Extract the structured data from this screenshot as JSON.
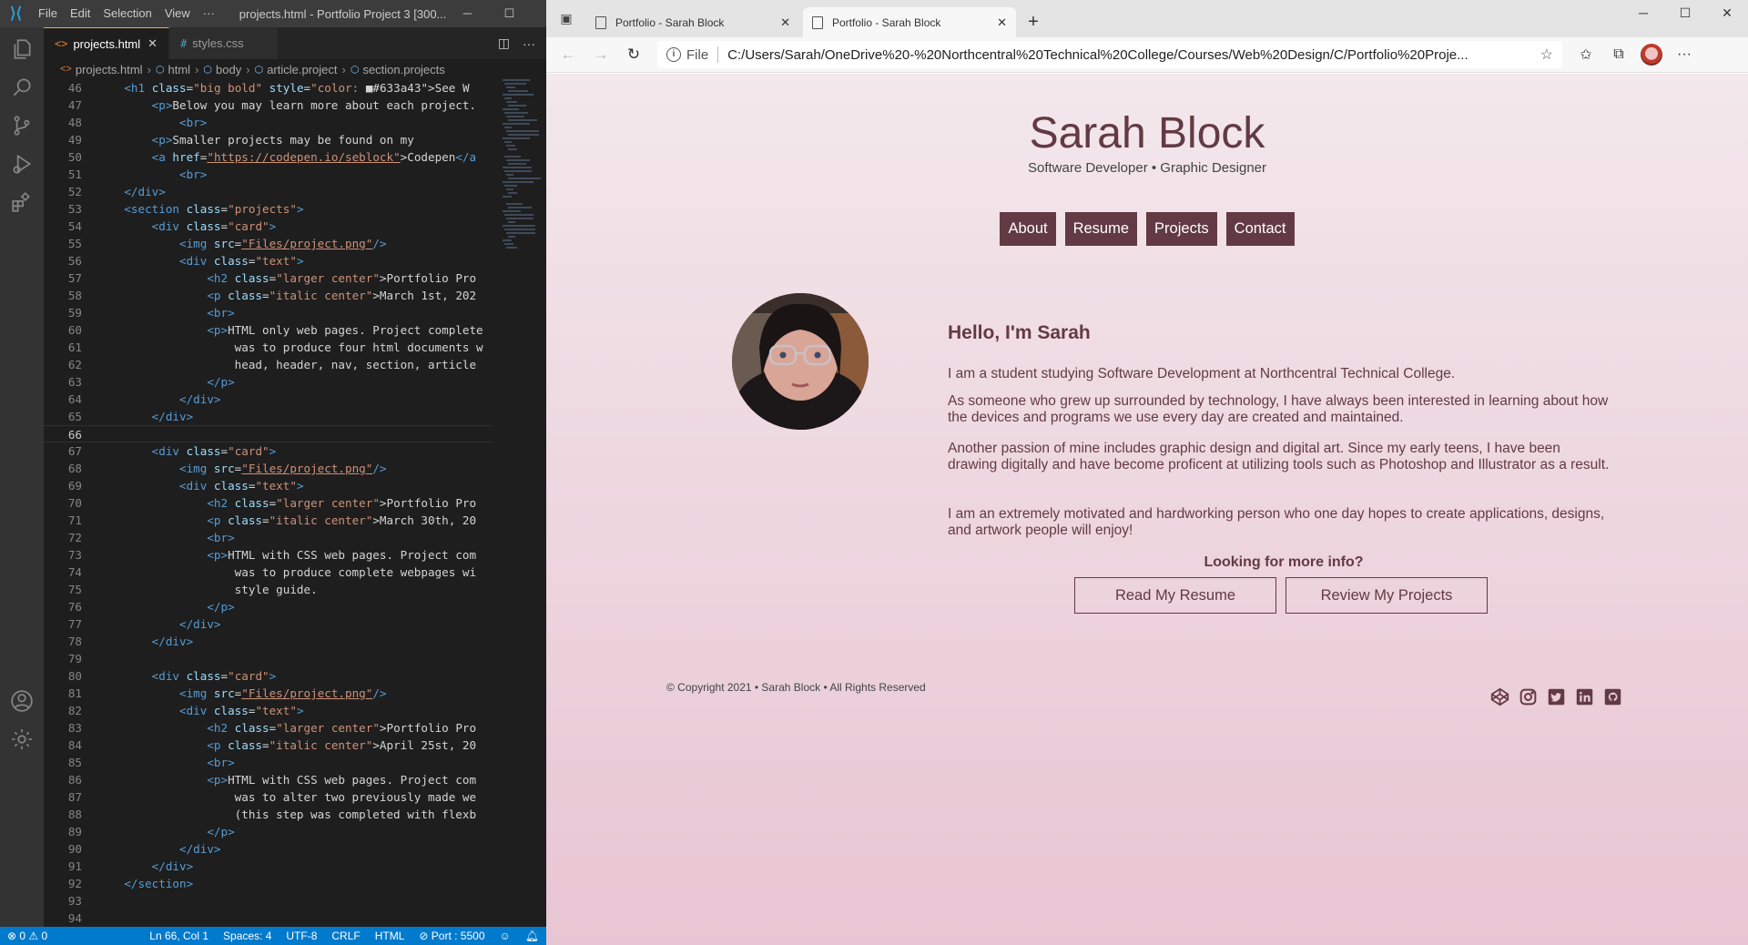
{
  "vscode": {
    "title": "projects.html - Portfolio Project 3 [300...",
    "menu": [
      "File",
      "Edit",
      "Selection",
      "View",
      "···"
    ],
    "tabs": [
      {
        "label": "projects.html",
        "active": true,
        "icon": "html-file-icon"
      },
      {
        "label": "styles.css",
        "active": false,
        "icon": "css-file-icon"
      }
    ],
    "breadcrumb": [
      "projects.html",
      "html",
      "body",
      "article.project",
      "section.projects"
    ],
    "code_lines": [
      {
        "n": 46,
        "ind": 4,
        "t": [
          [
            "tag",
            "<h1 "
          ],
          [
            "attr",
            "class"
          ],
          [
            "text",
            "="
          ],
          [
            "str",
            "\"big bold\""
          ],
          [
            "text",
            " "
          ],
          [
            "attr",
            "style"
          ],
          [
            "text",
            "="
          ],
          [
            "str",
            "\"color: "
          ],
          [
            "text",
            "■#633a43\">See W"
          ]
        ]
      },
      {
        "n": 47,
        "ind": 8,
        "t": [
          [
            "tag",
            "<p>"
          ],
          [
            "text",
            "Below you may learn more about each project."
          ]
        ]
      },
      {
        "n": 48,
        "ind": 12,
        "t": [
          [
            "tag",
            "<br>"
          ]
        ]
      },
      {
        "n": 49,
        "ind": 8,
        "t": [
          [
            "tag",
            "<p>"
          ],
          [
            "text",
            "Smaller projects may be found on my"
          ]
        ]
      },
      {
        "n": 50,
        "ind": 8,
        "t": [
          [
            "tag",
            "<a "
          ],
          [
            "attr",
            "href"
          ],
          [
            "text",
            "="
          ],
          [
            "link",
            "\"https://codepen.io/seblock\""
          ],
          [
            "text",
            ">Codepen"
          ],
          [
            "tag",
            "</a"
          ]
        ]
      },
      {
        "n": 51,
        "ind": 12,
        "t": [
          [
            "tag",
            "<br>"
          ]
        ]
      },
      {
        "n": 52,
        "ind": 4,
        "t": [
          [
            "tag",
            "</div>"
          ]
        ]
      },
      {
        "n": 53,
        "ind": 4,
        "t": [
          [
            "tag",
            "<section "
          ],
          [
            "attr",
            "class"
          ],
          [
            "text",
            "="
          ],
          [
            "str",
            "\"projects\""
          ],
          [
            "tag",
            ">"
          ]
        ]
      },
      {
        "n": 54,
        "ind": 8,
        "t": [
          [
            "tag",
            "<div "
          ],
          [
            "attr",
            "class"
          ],
          [
            "text",
            "="
          ],
          [
            "str",
            "\"card\""
          ],
          [
            "tag",
            ">"
          ]
        ]
      },
      {
        "n": 55,
        "ind": 12,
        "t": [
          [
            "tag",
            "<img "
          ],
          [
            "attr",
            "src"
          ],
          [
            "text",
            "="
          ],
          [
            "link",
            "\"Files/project.png\""
          ],
          [
            "tag",
            "/>"
          ]
        ]
      },
      {
        "n": 56,
        "ind": 12,
        "t": [
          [
            "tag",
            "<div "
          ],
          [
            "attr",
            "class"
          ],
          [
            "text",
            "="
          ],
          [
            "str",
            "\"text\""
          ],
          [
            "tag",
            ">"
          ]
        ]
      },
      {
        "n": 57,
        "ind": 16,
        "t": [
          [
            "tag",
            "<h2 "
          ],
          [
            "attr",
            "class"
          ],
          [
            "text",
            "="
          ],
          [
            "str",
            "\"larger center\""
          ],
          [
            "text",
            ">Portfolio Pro"
          ]
        ]
      },
      {
        "n": 58,
        "ind": 16,
        "t": [
          [
            "tag",
            "<p "
          ],
          [
            "attr",
            "class"
          ],
          [
            "text",
            "="
          ],
          [
            "str",
            "\"italic center\""
          ],
          [
            "text",
            ">March 1st, 202"
          ]
        ]
      },
      {
        "n": 59,
        "ind": 16,
        "t": [
          [
            "tag",
            "<br>"
          ]
        ]
      },
      {
        "n": 60,
        "ind": 16,
        "t": [
          [
            "tag",
            "<p>"
          ],
          [
            "text",
            "HTML only web pages. Project complete"
          ]
        ]
      },
      {
        "n": 61,
        "ind": 20,
        "t": [
          [
            "text",
            "was to produce four html documents w"
          ]
        ]
      },
      {
        "n": 62,
        "ind": 20,
        "t": [
          [
            "text",
            "head, header, nav, section, article"
          ]
        ]
      },
      {
        "n": 63,
        "ind": 16,
        "t": [
          [
            "tag",
            "</p>"
          ]
        ]
      },
      {
        "n": 64,
        "ind": 12,
        "t": [
          [
            "tag",
            "</div>"
          ]
        ]
      },
      {
        "n": 65,
        "ind": 8,
        "t": [
          [
            "tag",
            "</div>"
          ]
        ]
      },
      {
        "n": 66,
        "ind": 0,
        "t": [],
        "current": true
      },
      {
        "n": 67,
        "ind": 8,
        "t": [
          [
            "tag",
            "<div "
          ],
          [
            "attr",
            "class"
          ],
          [
            "text",
            "="
          ],
          [
            "str",
            "\"card\""
          ],
          [
            "tag",
            ">"
          ]
        ]
      },
      {
        "n": 68,
        "ind": 12,
        "t": [
          [
            "tag",
            "<img "
          ],
          [
            "attr",
            "src"
          ],
          [
            "text",
            "="
          ],
          [
            "link",
            "\"Files/project.png\""
          ],
          [
            "tag",
            "/>"
          ]
        ]
      },
      {
        "n": 69,
        "ind": 12,
        "t": [
          [
            "tag",
            "<div "
          ],
          [
            "attr",
            "class"
          ],
          [
            "text",
            "="
          ],
          [
            "str",
            "\"text\""
          ],
          [
            "tag",
            ">"
          ]
        ]
      },
      {
        "n": 70,
        "ind": 16,
        "t": [
          [
            "tag",
            "<h2 "
          ],
          [
            "attr",
            "class"
          ],
          [
            "text",
            "="
          ],
          [
            "str",
            "\"larger center\""
          ],
          [
            "text",
            ">Portfolio Pro"
          ]
        ]
      },
      {
        "n": 71,
        "ind": 16,
        "t": [
          [
            "tag",
            "<p "
          ],
          [
            "attr",
            "class"
          ],
          [
            "text",
            "="
          ],
          [
            "str",
            "\"italic center\""
          ],
          [
            "text",
            ">March 30th, 20"
          ]
        ]
      },
      {
        "n": 72,
        "ind": 16,
        "t": [
          [
            "tag",
            "<br>"
          ]
        ]
      },
      {
        "n": 73,
        "ind": 16,
        "t": [
          [
            "tag",
            "<p>"
          ],
          [
            "text",
            "HTML with CSS web pages. Project com"
          ]
        ]
      },
      {
        "n": 74,
        "ind": 20,
        "t": [
          [
            "text",
            "was to produce complete webpages wi"
          ]
        ]
      },
      {
        "n": 75,
        "ind": 20,
        "t": [
          [
            "text",
            "style guide."
          ]
        ]
      },
      {
        "n": 76,
        "ind": 16,
        "t": [
          [
            "tag",
            "</p>"
          ]
        ]
      },
      {
        "n": 77,
        "ind": 12,
        "t": [
          [
            "tag",
            "</div>"
          ]
        ]
      },
      {
        "n": 78,
        "ind": 8,
        "t": [
          [
            "tag",
            "</div>"
          ]
        ]
      },
      {
        "n": 79,
        "ind": 0,
        "t": []
      },
      {
        "n": 80,
        "ind": 8,
        "t": [
          [
            "tag",
            "<div "
          ],
          [
            "attr",
            "class"
          ],
          [
            "text",
            "="
          ],
          [
            "str",
            "\"card\""
          ],
          [
            "tag",
            ">"
          ]
        ]
      },
      {
        "n": 81,
        "ind": 12,
        "t": [
          [
            "tag",
            "<img "
          ],
          [
            "attr",
            "src"
          ],
          [
            "text",
            "="
          ],
          [
            "link",
            "\"Files/project.png\""
          ],
          [
            "tag",
            "/>"
          ]
        ]
      },
      {
        "n": 82,
        "ind": 12,
        "t": [
          [
            "tag",
            "<div "
          ],
          [
            "attr",
            "class"
          ],
          [
            "text",
            "="
          ],
          [
            "str",
            "\"text\""
          ],
          [
            "tag",
            ">"
          ]
        ]
      },
      {
        "n": 83,
        "ind": 16,
        "t": [
          [
            "tag",
            "<h2 "
          ],
          [
            "attr",
            "class"
          ],
          [
            "text",
            "="
          ],
          [
            "str",
            "\"larger center\""
          ],
          [
            "text",
            ">Portfolio Pro"
          ]
        ]
      },
      {
        "n": 84,
        "ind": 16,
        "t": [
          [
            "tag",
            "<p "
          ],
          [
            "attr",
            "class"
          ],
          [
            "text",
            "="
          ],
          [
            "str",
            "\"italic center\""
          ],
          [
            "text",
            ">April 25st, 20"
          ]
        ]
      },
      {
        "n": 85,
        "ind": 16,
        "t": [
          [
            "tag",
            "<br>"
          ]
        ]
      },
      {
        "n": 86,
        "ind": 16,
        "t": [
          [
            "tag",
            "<p>"
          ],
          [
            "text",
            "HTML with CSS web pages. Project com"
          ]
        ]
      },
      {
        "n": 87,
        "ind": 20,
        "t": [
          [
            "text",
            "was to alter two previously made we"
          ]
        ]
      },
      {
        "n": 88,
        "ind": 20,
        "t": [
          [
            "text",
            "(this step was completed with flexb"
          ]
        ]
      },
      {
        "n": 89,
        "ind": 16,
        "t": [
          [
            "tag",
            "</p>"
          ]
        ]
      },
      {
        "n": 90,
        "ind": 12,
        "t": [
          [
            "tag",
            "</div>"
          ]
        ]
      },
      {
        "n": 91,
        "ind": 8,
        "t": [
          [
            "tag",
            "</div>"
          ]
        ]
      },
      {
        "n": 92,
        "ind": 4,
        "t": [
          [
            "tag",
            "</section>"
          ]
        ]
      },
      {
        "n": 93,
        "ind": 0,
        "t": []
      },
      {
        "n": 94,
        "ind": 0,
        "t": []
      }
    ],
    "status": {
      "problems": "⊗ 0 ⚠ 0",
      "position": "Ln 66, Col 1",
      "spaces": "Spaces: 4",
      "encoding": "UTF-8",
      "eol": "CRLF",
      "language": "HTML",
      "port": "⊘ Port : 5500"
    }
  },
  "browser": {
    "tabs": [
      {
        "title": "Portfolio - Sarah Block",
        "active": false
      },
      {
        "title": "Portfolio - Sarah Block",
        "active": true
      }
    ],
    "address_prefix": "File",
    "url": "C:/Users/Sarah/OneDrive%20-%20Northcentral%20Technical%20College/Courses/Web%20Design/C/Portfolio%20Proje...",
    "page": {
      "name": "Sarah Block",
      "tagline": "Software Developer • Graphic Designer",
      "nav": [
        "About",
        "Resume",
        "Projects",
        "Contact"
      ],
      "greeting": "Hello, I'm Sarah",
      "bio": [
        "I am a student studying Software Development at Northcentral Technical College.",
        "As someone who grew up surrounded by technology, I have always been interested in learning about how the devices and programs we use every day are created and maintained.",
        "Another passion of mine includes graphic design and digital art. Since my early teens, I have been drawing digitally and have become proficent at utilizing tools such as Photoshop and Illustrator as a result.",
        "I am an extremely motivated and hardworking person who one day hopes to create applications, designs, and artwork people will enjoy!"
      ],
      "more_info": "Looking for more info?",
      "cta": [
        "Read My Resume",
        "Review My Projects"
      ],
      "copyright": "© Copyright 2021 • Sarah Block • All Rights Reserved",
      "social_icons": [
        "codepen-icon",
        "instagram-icon",
        "twitter-icon",
        "linkedin-icon",
        "github-icon"
      ],
      "accent_color": "#633a43"
    }
  }
}
